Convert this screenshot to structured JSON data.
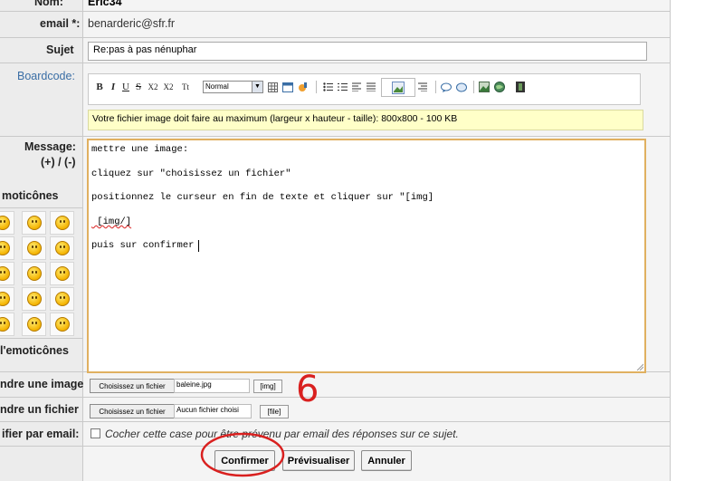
{
  "form": {
    "nom": {
      "label": "Nom:",
      "value": "Eric34"
    },
    "email": {
      "label": "email *:",
      "value": "benarderic@sfr.fr"
    },
    "sujet": {
      "label": "Sujet",
      "value": "Re:pas à pas nénuphar"
    },
    "boardcode": {
      "label": "Boardcode:"
    },
    "toolbar": {
      "bold": "B",
      "italic": "I",
      "underline": "U",
      "strike": "S",
      "subscript": "X2",
      "superscript": "X2",
      "teletype": "Tt",
      "size_select": "Normal"
    },
    "notice": "Votre fichier image doit faire au maximum (largeur x hauteur - taille): 800x800 - 100 KB",
    "message": {
      "label": "Message:",
      "counter": "(+) / (-)",
      "lines": [
        "mettre une image:",
        "cliquez sur \"choisissez un fichier\"",
        "positionnez le curseur en fin de texte et cliquer sur \"[img]",
        " [img/]",
        "puis sur confirmer"
      ]
    },
    "emoticons": {
      "title": "moticônes",
      "more_link": "l'emoticônes"
    },
    "joindre_image": {
      "label": "ndre une image",
      "choose_button": "Choisissez un fichier",
      "file_name": "baleine.jpg",
      "tag_button": "[img]"
    },
    "joindre_fichier": {
      "label": "ndre un fichier",
      "choose_button": "Choisissez un fichier",
      "file_name": "Aucun fichier choisi",
      "tag_button": "[file]"
    },
    "notifier": {
      "label": "ifier par email:",
      "checkbox_text": "Cocher cette case pour être prévenu par email des réponses sur ce sujet."
    },
    "buttons": {
      "confirm": "Confirmer",
      "preview": "Prévisualiser",
      "cancel": "Annuler"
    }
  },
  "annotation": {
    "step_number": "6",
    "color": "#d9201f"
  }
}
